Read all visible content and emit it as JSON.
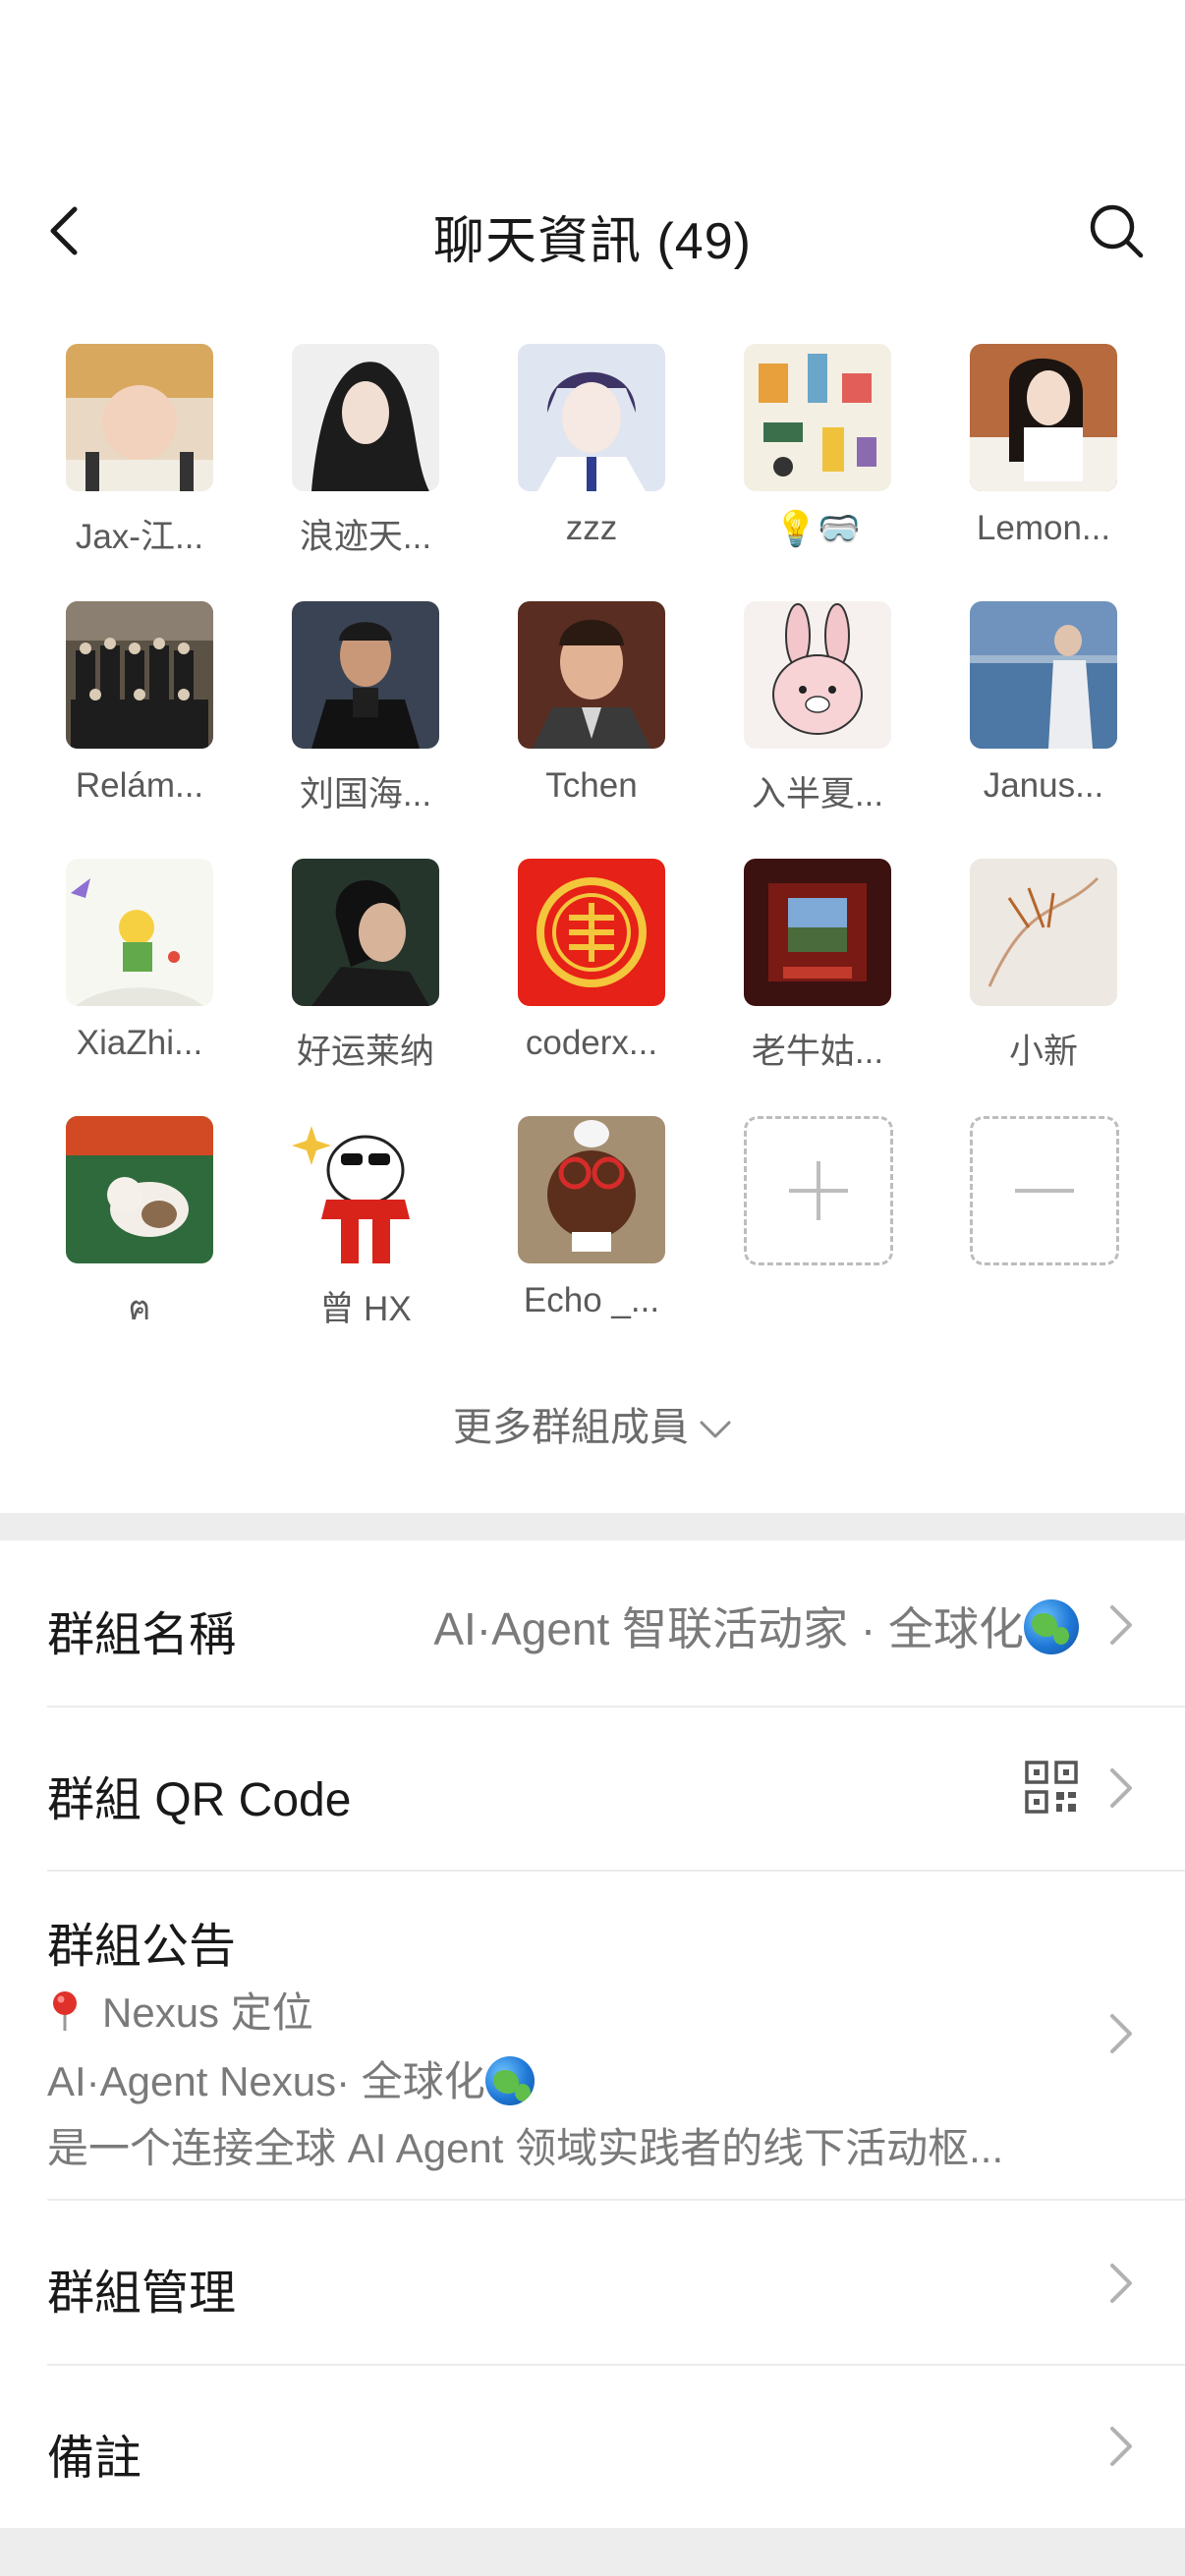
{
  "header": {
    "title": "聊天資訊 (49)"
  },
  "members": [
    {
      "name": "Jax-江..."
    },
    {
      "name": "浪迹天..."
    },
    {
      "name": "zzz"
    },
    {
      "name": "💡🥽"
    },
    {
      "name": "Lemon..."
    },
    {
      "name": "Relám..."
    },
    {
      "name": "刘国海..."
    },
    {
      "name": "Tchen"
    },
    {
      "name": "入半夏..."
    },
    {
      "name": "Janus..."
    },
    {
      "name": "XiaZhi..."
    },
    {
      "name": "好运莱纳"
    },
    {
      "name": "coderx..."
    },
    {
      "name": "老牛姑..."
    },
    {
      "name": "小新"
    },
    {
      "name": "ฅ"
    },
    {
      "name": "曾 HX"
    },
    {
      "name": "Echo _..."
    }
  ],
  "more_members_label": "更多群組成員",
  "settings": {
    "group_name_label": "群組名稱",
    "group_name_value": "AI·Agent 智联活动家 · 全球化",
    "qr_label": "群組 QR Code",
    "notice_label": "群組公告",
    "notice_line1": "Nexus 定位",
    "notice_line2": "AI·Agent Nexus· 全球化",
    "notice_line3": "是一个连接全球 AI Agent 领域实践者的线下活动枢...",
    "manage_label": "群組管理",
    "remark_label": "備註"
  },
  "colors": {
    "background": "#ededed",
    "card": "#ffffff",
    "secondary_text": "#7a7a7a"
  }
}
